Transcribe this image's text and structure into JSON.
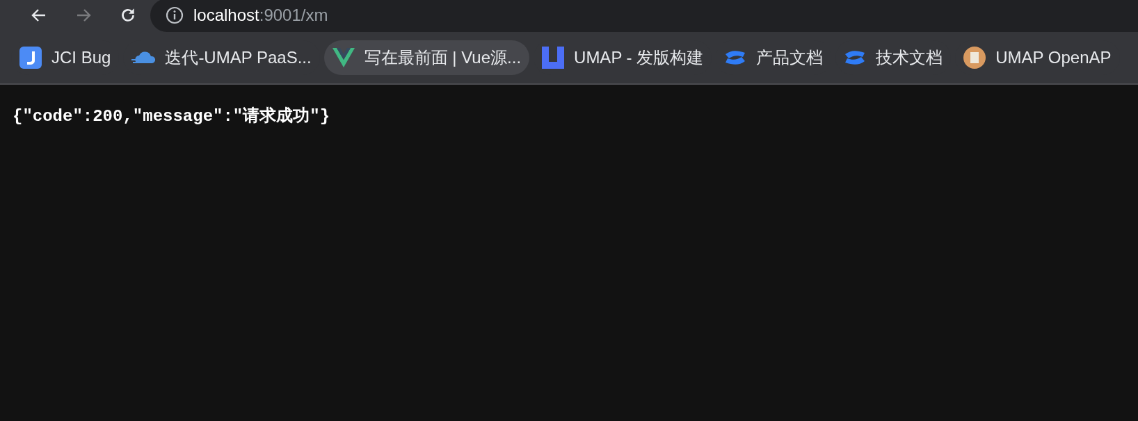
{
  "toolbar": {
    "back": {
      "disabled": false
    },
    "forward": {
      "disabled": true
    }
  },
  "address_bar": {
    "host": "localhost",
    "path": ":9001/xm"
  },
  "bookmarks": [
    {
      "kind": "j-tile",
      "label": "JCI Bug",
      "hovered": false
    },
    {
      "kind": "cloud",
      "label": "迭代-UMAP PaaS...",
      "hovered": false
    },
    {
      "kind": "v-logo",
      "label": "写在最前面 | Vue源...",
      "hovered": true
    },
    {
      "kind": "u-tile",
      "label": "UMAP - 发版构建",
      "hovered": false
    },
    {
      "kind": "swirl",
      "label": "产品文档",
      "hovered": false
    },
    {
      "kind": "swirl",
      "label": "技术文档",
      "hovered": false
    },
    {
      "kind": "doc",
      "label": "UMAP OpenAP",
      "hovered": false
    }
  ],
  "page": {
    "body": "{\"code\":200,\"message\":\"请求成功\"}"
  }
}
